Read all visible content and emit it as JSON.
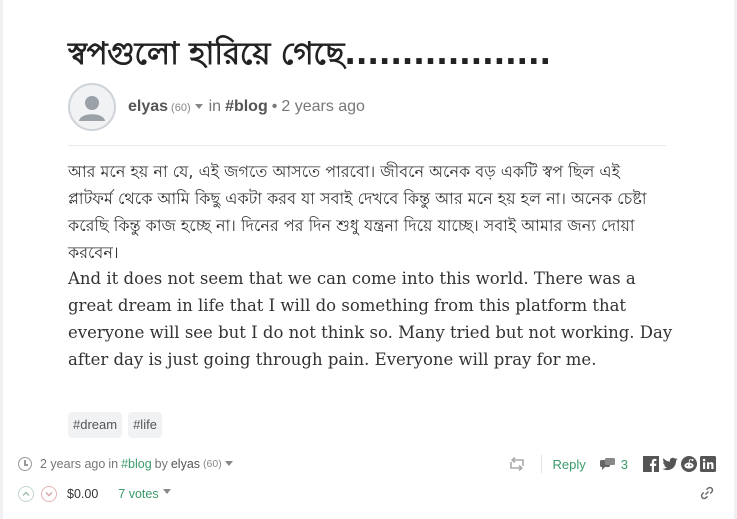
{
  "post": {
    "title": "স্বপগুলো হারিয়ে গেছে..................",
    "author": "elyas",
    "reputation": "(60)",
    "in_label": "in",
    "category": "#blog",
    "dot": "•",
    "age": "2 years ago",
    "body_bengali": "আর মনে হয় না যে, এই জগতে আসতে পারবো। জীবনে অনেক বড় একটি স্বপ ছিল এই প্লাটফর্ম থেকে আমি কিছু একটা করব যা সবাই দেখবে কিন্তু আর মনে হয় হল না। অনেক চেষ্টা করেছি কিন্তু কাজ হচ্ছে না। দিনের পর দিন শুধু যন্ত্রনা দিয়ে যাচ্ছে। সবাই আমার জন্য দোয়া করবেন।",
    "body_english": "And it does not seem that we can come into this world. There was a great dream in life that I will do something from this platform that everyone will see but I do not think so. Many tried but not working. Day after day is just going through pain. Everyone will pray for me.",
    "tags": [
      "#dream",
      "#life"
    ]
  },
  "footer": {
    "age": "2 years ago",
    "in_label": "in",
    "category": "#blog",
    "by_label": "by",
    "author": "elyas",
    "reputation": "(60)",
    "reply_label": "Reply",
    "comment_count": "3",
    "payout": "$0.00",
    "votes_label": "7 votes"
  },
  "icons": {
    "avatar": "user-avatar-icon",
    "clock": "clock-icon",
    "reblog": "reblog-icon",
    "comments": "comments-icon",
    "share": [
      "facebook-icon",
      "twitter-icon",
      "reddit-icon",
      "linkedin-icon"
    ],
    "upvote": "upvote-icon",
    "downvote": "downvote-icon",
    "permalink": "link-icon"
  },
  "colors": {
    "accent": "#3a9a6a",
    "text": "#333333",
    "muted": "#777777"
  }
}
